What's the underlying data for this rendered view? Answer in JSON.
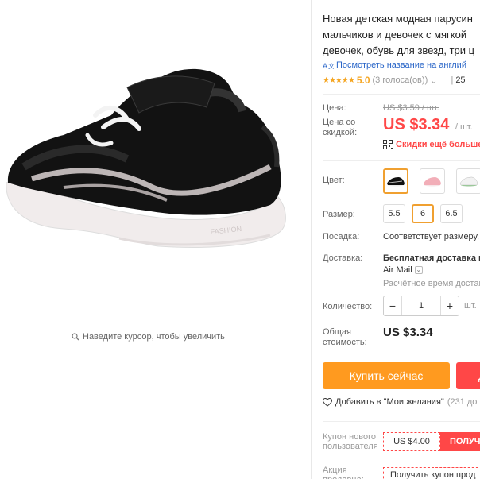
{
  "product": {
    "title_lines": [
      "Новая детская модная парусин",
      "мальчиков и девочек с мягкой",
      "девочек, обувь для звезд, три ц"
    ],
    "see_translation": "Посмотреть название на англий",
    "rating": "5.0",
    "votes": "(3 голоса(ов))",
    "orders": "25",
    "zoom_hint": "Наведите курсор, чтобы увеличить"
  },
  "price": {
    "price_label": "Цена:",
    "old_price": "US $3.59 / шт.",
    "discount_label": "Цена со скидкой:",
    "new_price": "US $3.34",
    "unit": "/ шт.",
    "qr_discount": "Скидки ещё больше"
  },
  "options": {
    "color_label": "Цвет:",
    "size_label": "Размер:",
    "sizes": [
      "5.5",
      "6",
      "6.5"
    ],
    "selected_size": "6",
    "fit_label": "Посадка:",
    "fit_value": "Соответствует размеру,"
  },
  "shipping": {
    "label": "Доставка:",
    "free": "Бесплатная доставка в",
    "method": "Air Mail",
    "estimate": "Расчётное время доставк"
  },
  "quantity": {
    "label": "Количество:",
    "value": "1",
    "minus": "−",
    "plus": "+",
    "unit": "шт."
  },
  "total": {
    "label": "Общая стоимость:",
    "value": "US $3.34"
  },
  "actions": {
    "buy_now": "Купить сейчас",
    "add_to_cart": "Д",
    "wishlist": "Добавить в \"Мои желания\"",
    "wishlist_count": "(231 до"
  },
  "coupons": {
    "new_user_label": "Купон нового пользователя",
    "new_user_amount": "US $4.00",
    "get": "ПОЛУЧЕ",
    "promo_label": "Акция продавца:",
    "promo_text": "Получить купон прод"
  },
  "colors": {
    "accent_orange": "#ff9a1f",
    "price_red": "#ff4747",
    "selected_border": "#f0a030",
    "link_blue": "#2a66c8"
  }
}
